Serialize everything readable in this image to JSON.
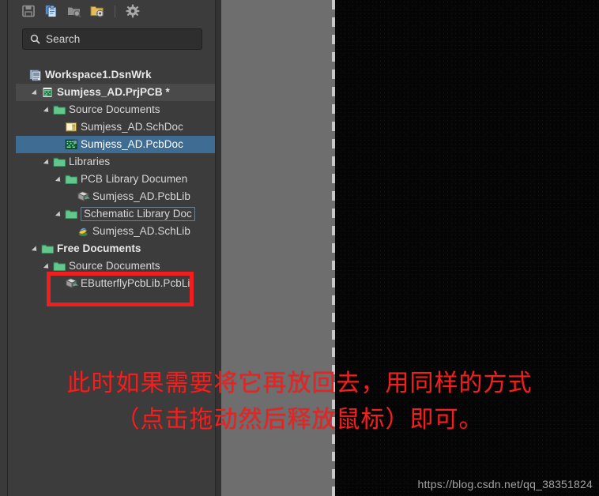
{
  "toolbar": {
    "buttons": [
      {
        "name": "save-icon",
        "title": "Save",
        "state": "disabled"
      },
      {
        "name": "documents-icon",
        "title": "Documents",
        "state": "enabled"
      },
      {
        "name": "folder-search-icon",
        "title": "Browse",
        "state": "disabled"
      },
      {
        "name": "folder-options-icon",
        "title": "Project Options",
        "state": "enabled"
      },
      {
        "name": "separator",
        "title": "",
        "state": "static"
      },
      {
        "name": "gear-icon",
        "title": "Settings",
        "state": "enabled"
      }
    ]
  },
  "search": {
    "placeholder": "Search",
    "value": "",
    "icon": "search-icon"
  },
  "tree": {
    "items": [
      {
        "label": "Workspace1.DsnWrk",
        "indent": 0,
        "arrow": false,
        "icon": "workspace-icon",
        "bold": true,
        "state": "normal"
      },
      {
        "label": "Sumjess_AD.PrjPCB *",
        "indent": 1,
        "arrow": true,
        "icon": "project-pcb-icon",
        "bold": true,
        "state": "hovered"
      },
      {
        "label": "Source Documents",
        "indent": 2,
        "arrow": true,
        "icon": "folder-icon",
        "bold": false,
        "state": "normal"
      },
      {
        "label": "Sumjess_AD.SchDoc",
        "indent": 3,
        "arrow": false,
        "icon": "schdoc-icon",
        "bold": false,
        "state": "normal"
      },
      {
        "label": "Sumjess_AD.PcbDoc",
        "indent": 3,
        "arrow": false,
        "icon": "pcbdoc-icon",
        "bold": false,
        "state": "selected"
      },
      {
        "label": "Libraries",
        "indent": 2,
        "arrow": true,
        "icon": "folder-icon",
        "bold": false,
        "state": "normal"
      },
      {
        "label": "PCB Library Documen",
        "indent": 3,
        "arrow": true,
        "icon": "folder-icon",
        "bold": false,
        "state": "normal"
      },
      {
        "label": "Sumjess_AD.PcbLib",
        "indent": 4,
        "arrow": false,
        "icon": "pcblib-icon",
        "bold": false,
        "state": "normal"
      },
      {
        "label": "Schematic Library Doc",
        "indent": 3,
        "arrow": true,
        "icon": "folder-icon",
        "bold": false,
        "state": "outlined"
      },
      {
        "label": "Sumjess_AD.SchLib",
        "indent": 4,
        "arrow": false,
        "icon": "schlib-icon",
        "bold": false,
        "state": "normal"
      },
      {
        "label": "Free Documents",
        "indent": 1,
        "arrow": true,
        "icon": "folder-icon",
        "bold": true,
        "state": "normal"
      },
      {
        "label": "Source Documents",
        "indent": 2,
        "arrow": true,
        "icon": "folder-icon",
        "bold": false,
        "state": "normal"
      },
      {
        "label": "EButterflyPcbLib.PcbLi",
        "indent": 3,
        "arrow": false,
        "icon": "pcblib-icon",
        "bold": false,
        "state": "normal"
      }
    ]
  },
  "annotation": {
    "box_color": "#f01e1e",
    "box_target": "EButterflyPcbLib.PcbLi",
    "text_line1": "此时如果需要将它再放回去，用同样的方式",
    "text_line2": "（点击拖动然后释放鼠标）即可。",
    "text_color": "#ef2020"
  },
  "watermark": {
    "text": "https://blog.csdn.net/qq_38351824"
  },
  "canvas": {
    "name": "pcb-editor-canvas",
    "background": "#050505"
  },
  "colors": {
    "panel_bg": "#3c3c3c",
    "dock_bg": "#333333",
    "selection": "#3e6c93",
    "grey_band": "#6e6e6e",
    "text": "#d8d8d8"
  }
}
